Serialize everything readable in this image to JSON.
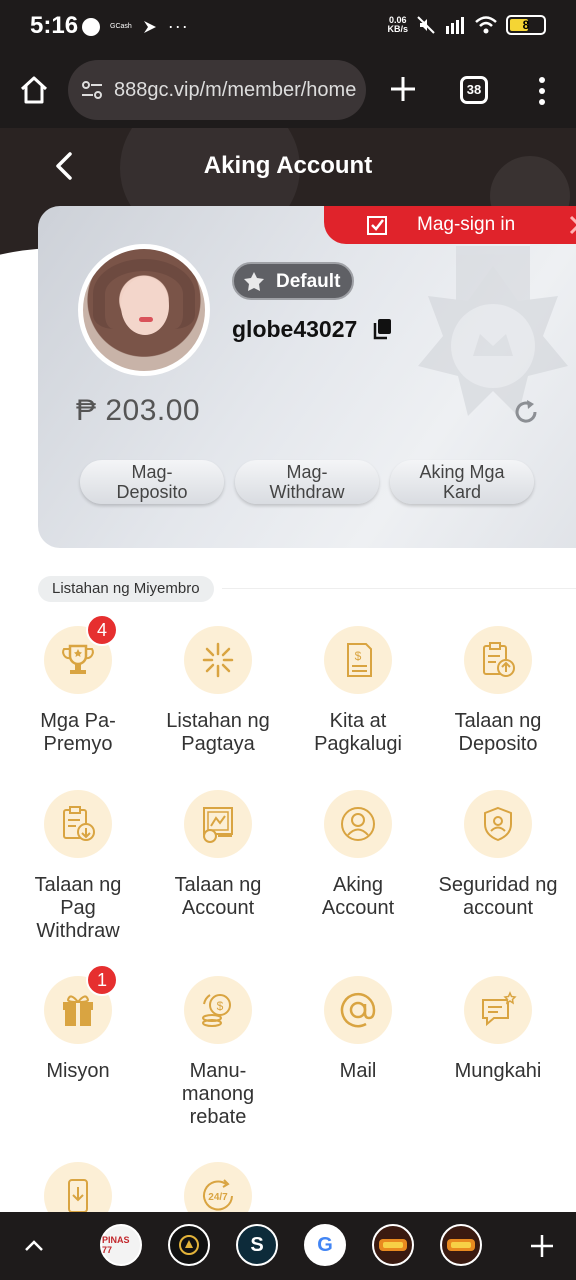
{
  "status_bar": {
    "time": "5:16",
    "gcash_label": "GCash",
    "net_speed_value": "0.06",
    "net_speed_unit": "KB/s",
    "battery": "8"
  },
  "browser": {
    "url": "888gc.vip/m/member/home",
    "tab_count": "38"
  },
  "header": {
    "title": "Aking Account"
  },
  "account": {
    "sign_in_label": "Mag-sign in",
    "level_label": "Default",
    "username": "globe43027",
    "balance": "₱ 203.00",
    "buttons": [
      {
        "line1": "Mag-",
        "line2": "Deposito"
      },
      {
        "line1": "Mag-",
        "line2": "Withdraw"
      },
      {
        "line1": "Aking Mga",
        "line2": "Kard"
      }
    ]
  },
  "member_list": {
    "title": "Listahan ng Miyembro",
    "items": [
      {
        "label": "Mga Pa-\nPremyo",
        "badge": "4",
        "icon": "trophy-icon"
      },
      {
        "label": "Listahan ng\nPagtaya",
        "badge": "",
        "icon": "sparkle-icon"
      },
      {
        "label": "Kita at\nPagkalugi",
        "badge": "",
        "icon": "profit-icon"
      },
      {
        "label": "Talaan ng\nDeposito",
        "badge": "",
        "icon": "deposit-record-icon"
      },
      {
        "label": "Talaan ng\nPag\nWithdraw",
        "badge": "",
        "icon": "withdraw-record-icon"
      },
      {
        "label": "Talaan ng\nAccount",
        "badge": "",
        "icon": "account-record-icon"
      },
      {
        "label": "Aking\nAccount",
        "badge": "",
        "icon": "user-icon"
      },
      {
        "label": "Seguridad ng\naccount",
        "badge": "",
        "icon": "shield-icon"
      },
      {
        "label": "Misyon",
        "badge": "1",
        "icon": "gift-icon"
      },
      {
        "label": "Manu-\nmanong\nrebate",
        "badge": "",
        "icon": "coins-icon"
      },
      {
        "label": "Mail",
        "badge": "",
        "icon": "mail-icon"
      },
      {
        "label": "Mungkahi",
        "badge": "",
        "icon": "feedback-icon"
      },
      {
        "label": "",
        "badge": "",
        "icon": "download-icon"
      },
      {
        "label": "",
        "badge": "",
        "icon": "support-24-7-icon"
      }
    ]
  },
  "bottom_bar": {
    "tabs": [
      {
        "text": "PINAS 77",
        "icon": "pinas77-app-icon"
      },
      {
        "text": "",
        "icon": "app-icon"
      },
      {
        "text": "S",
        "icon": "s-app-icon"
      },
      {
        "text": "G",
        "icon": "google-icon"
      },
      {
        "text": "",
        "icon": "game-app-icon"
      },
      {
        "text": "",
        "icon": "game-app-icon-2"
      }
    ]
  },
  "colors": {
    "accent_red": "#e0232b",
    "gold_icon": "#d9a441",
    "icon_bg": "#fcefd6",
    "dark_bg": "#2a2322"
  }
}
